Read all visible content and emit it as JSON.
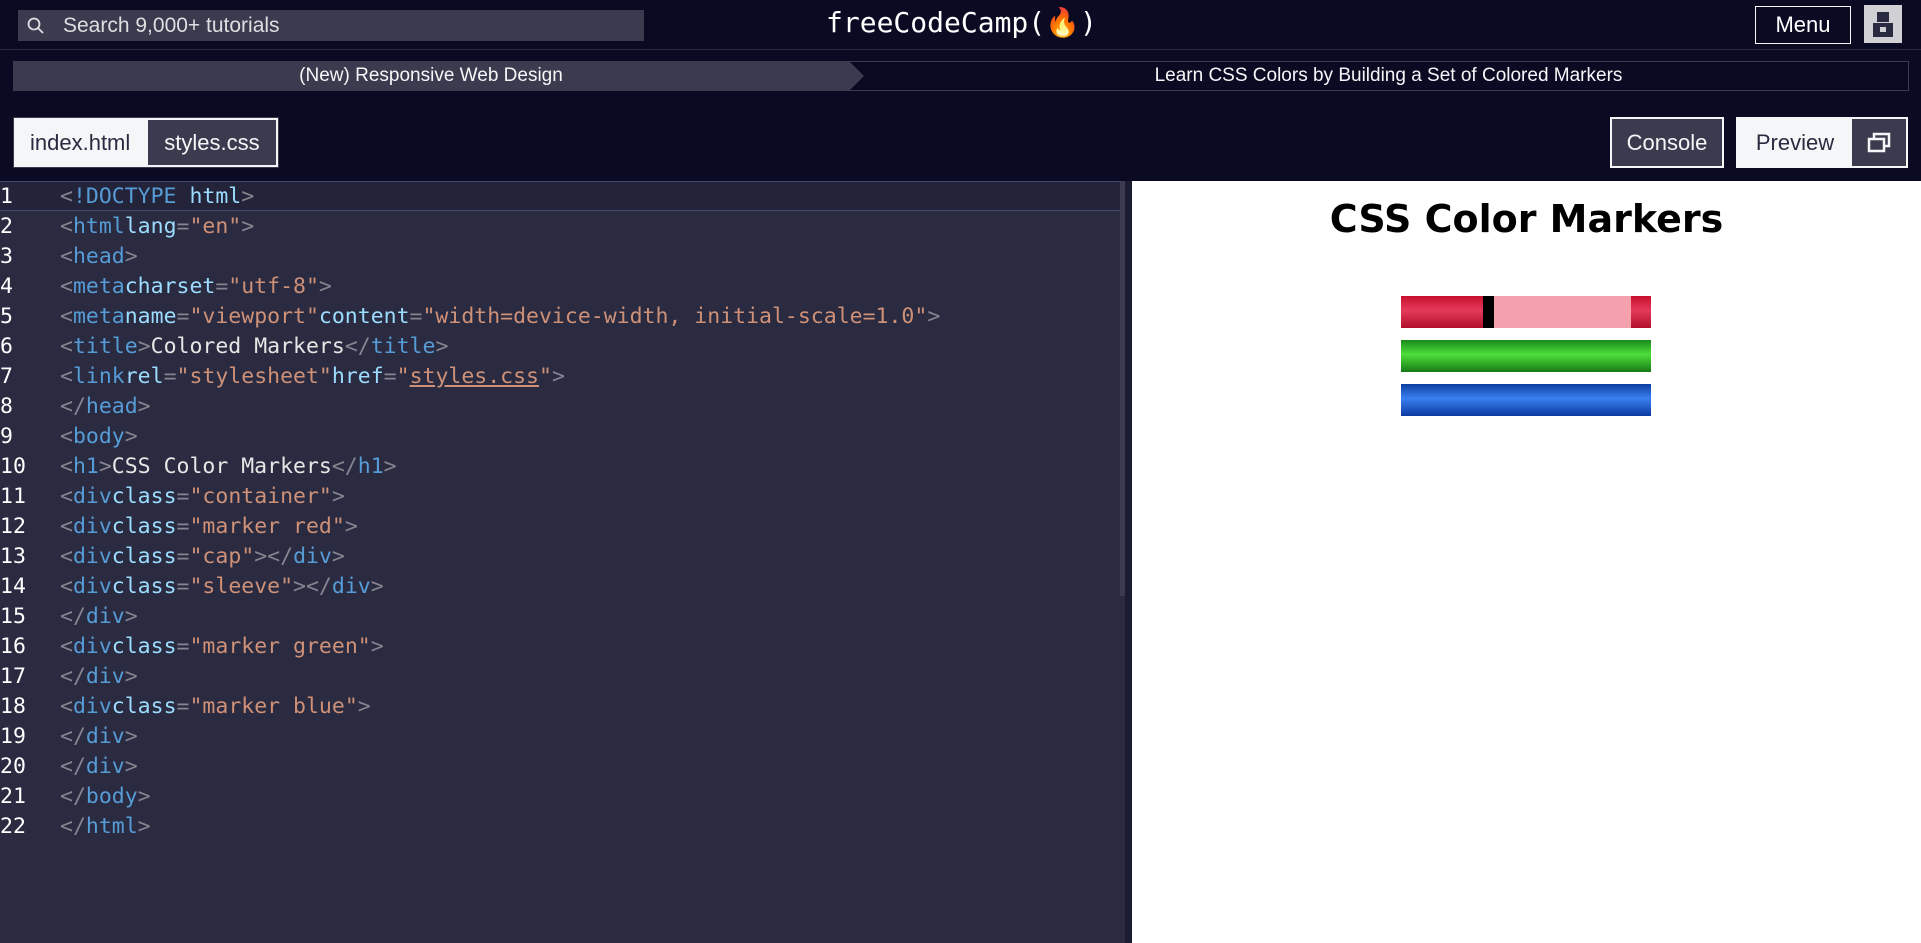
{
  "header": {
    "search_placeholder": "Search 9,000+ tutorials",
    "logo": "freeCodeCamp(🔥)",
    "menu_label": "Menu"
  },
  "breadcrumb": {
    "course": "(New) Responsive Web Design",
    "project": "Learn CSS Colors by Building a Set of Colored Markers"
  },
  "file_tabs": [
    "index.html",
    "styles.css"
  ],
  "panel_buttons": {
    "console": "Console",
    "preview": "Preview"
  },
  "editor": {
    "line_numbers": [
      "1",
      "2",
      "3",
      "4",
      "5",
      "6",
      "7",
      "8",
      "9",
      "10",
      "11",
      "12",
      "13",
      "14",
      "15",
      "16",
      "17",
      "18",
      "19",
      "20",
      "21",
      "22"
    ],
    "lines": [
      "<!DOCTYPE html>",
      "<html lang=\"en\">",
      "  <head>",
      "    <meta charset=\"utf-8\">",
      "    <meta name=\"viewport\" content=\"width=device-width, initial-scale=1.0\">",
      "    <title>Colored Markers</title>",
      "    <link rel=\"stylesheet\" href=\"styles.css\">",
      "  </head>",
      "  <body>",
      "    <h1>CSS Color Markers</h1>",
      "    <div class=\"container\">",
      "      <div class=\"marker red\">",
      "        <div class=\"cap\"></div>",
      "        <div class=\"sleeve\"></div>",
      "      </div>",
      "      <div class=\"marker green\">",
      "      </div>",
      "      <div class=\"marker blue\">",
      "      </div>",
      "    </div>",
      "  </body>",
      "</html>"
    ]
  },
  "preview": {
    "title": "CSS Color Markers",
    "markers": [
      "red",
      "green",
      "blue"
    ]
  },
  "colors": {
    "background": "#0a0a23",
    "editor_bg": "#2a2a40",
    "tag": "#569cd6",
    "attr": "#9cdcfe",
    "string": "#ce9178"
  }
}
